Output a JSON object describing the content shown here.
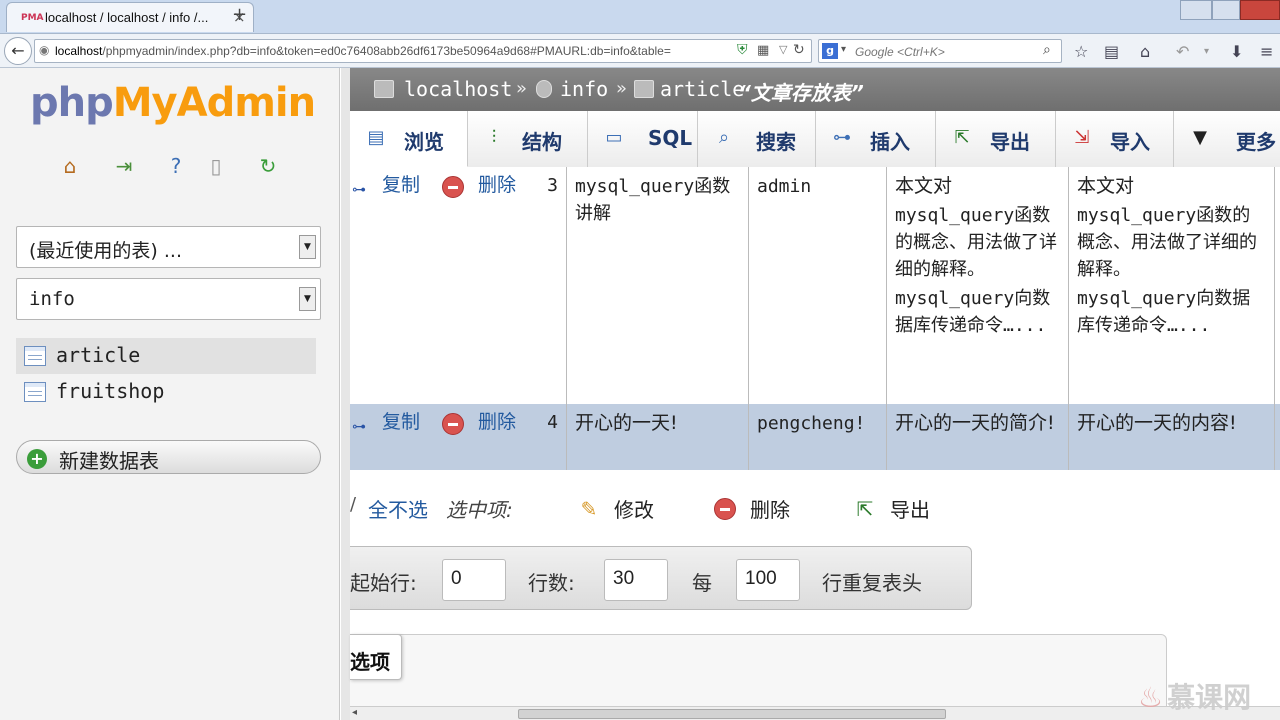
{
  "browser": {
    "tab_title": "localhost / localhost / info /...",
    "favicon": "PMA",
    "url_host": "localhost",
    "url_rest": "/phpmyadmin/index.php?db=info&token=ed0c76408abb26df6173be50964a9d68#PMAURL:db=info&table=",
    "search_placeholder": "Google <Ctrl+K>",
    "search_engine": "g"
  },
  "sidebar": {
    "logo_php": "php",
    "logo_myadmin": "MyAdmin",
    "recent_select": "(最近使用的表) ...",
    "db_select": "info",
    "tables": [
      {
        "name": "article"
      },
      {
        "name": "fruitshop"
      }
    ],
    "new_table_label": "新建数据表"
  },
  "breadcrumb": {
    "server": "localhost",
    "separator": "»",
    "database": "info",
    "table": "article",
    "table_comment": "“文章存放表”"
  },
  "tabs": [
    {
      "label": "浏览",
      "icon": "browse-icon"
    },
    {
      "label": "结构",
      "icon": "structure-icon"
    },
    {
      "label": "SQL",
      "icon": "sql-icon"
    },
    {
      "label": "搜索",
      "icon": "search-icon"
    },
    {
      "label": "插入",
      "icon": "insert-icon"
    },
    {
      "label": "导出",
      "icon": "export-icon"
    },
    {
      "label": "导入",
      "icon": "import-icon"
    },
    {
      "label": "更多",
      "icon": "more-icon"
    }
  ],
  "rows": [
    {
      "copy": "复制",
      "delete": "删除",
      "id": "3",
      "title": "mysql_query函数讲解",
      "author": "admin",
      "desc": [
        "本文对",
        "mysql_query函数的概念、用法做了详细的解释。",
        "mysql_query向数据库传递命令…..."
      ],
      "content": [
        "本文对",
        "mysql_query函数的概念、用法做了详细的解释。",
        "mysql_query向数据库传递命令…..."
      ]
    },
    {
      "copy": "复制",
      "delete": "删除",
      "id": "4",
      "title": "开心的一天!",
      "author": "pengcheng!",
      "desc": [
        "开心的一天的简介!"
      ],
      "content": [
        "开心的一天的内容!"
      ]
    }
  ],
  "bulk": {
    "unselect_all": "全不选",
    "with_selected": "选中项:",
    "edit": "修改",
    "delete": "删除",
    "export": "导出"
  },
  "pager": {
    "start_label": "起始行:",
    "start_value": "0",
    "rows_label": "行数:",
    "rows_value": "30",
    "every_label": "每",
    "every_value": "100",
    "repeat_label": "行重复表头"
  },
  "options_label": "选项",
  "watermark": "慕课网",
  "colors": {
    "logo_blue": "#6c78af",
    "logo_orange": "#f89c0e",
    "link": "#235a9f",
    "highlight_row": "#bfcde0"
  }
}
